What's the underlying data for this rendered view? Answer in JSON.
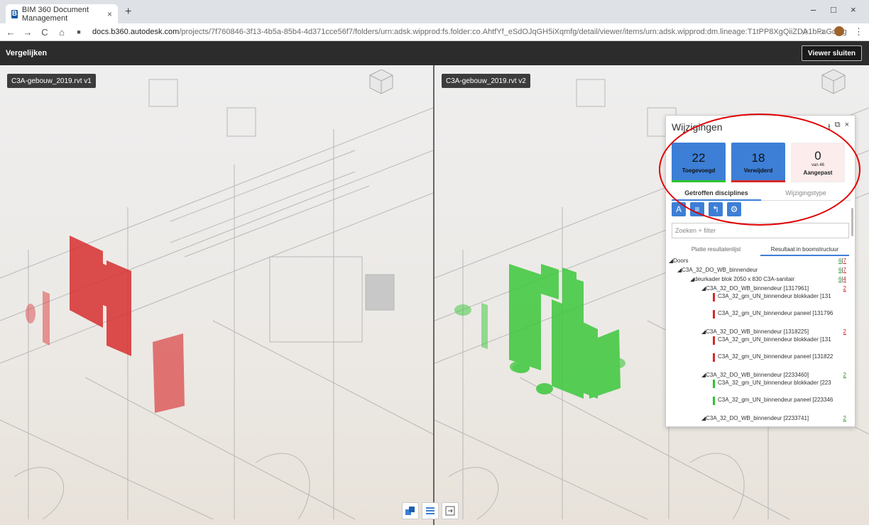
{
  "browser": {
    "tab_title": "BIM 360 Document Management",
    "tab_close": "×",
    "new_tab": "+",
    "url_host": "docs.b360.autodesk.com",
    "url_path": "/projects/7f760846-3f13-4b5a-85b4-4d371cce56f7/folders/urn:adsk.wipprod:fs.folder:co.AhtfYf_eSdOJqGH5iXqmfg/detail/viewer/items/urn:adsk.wipprod:dm.lineage:T1tPP8XgQiiZDA1bFaGcMg",
    "win_min": "–",
    "win_max": "□",
    "win_close": "×"
  },
  "app": {
    "title": "Vergelijken",
    "close_viewer": "Viewer sluiten"
  },
  "viewer": {
    "left_label": "C3A-gebouw_2019.rvt v1",
    "right_label": "C3A-gebouw_2019.rvt v2"
  },
  "changes_panel": {
    "title": "Wijzigingen",
    "added": {
      "count": "22",
      "label": "Toegevoegd"
    },
    "removed": {
      "count": "18",
      "label": "Verwijderd"
    },
    "modified": {
      "count": "0",
      "sub": "van 46",
      "label": "Aangepast"
    },
    "tab_disciplines": "Getroffen disciplines",
    "tab_change_type": "Wijzigingstype",
    "search_placeholder": "Zoeken + filter",
    "list_flat": "Platte resultatenlijst",
    "list_tree": "Resultaat in boomstructuur",
    "tree": [
      {
        "label": "◢Doors",
        "indent": 0,
        "added": "6",
        "removed": "7"
      },
      {
        "label": "◢C3A_32_DO_WB_binnendeur",
        "indent": 12,
        "added": "6",
        "removed": "7"
      },
      {
        "label": "◢deurkader blok 2050 x 830 C3A-sanitair",
        "indent": 30,
        "added": "6",
        "removed": "4"
      },
      {
        "label": "◢C3A_32_DO_WB_binnendeur [1317961]",
        "indent": 46,
        "removed": "2"
      },
      {
        "leaf": "C3A_32_gm_UN_binnendeur blokkader [131",
        "indent": 62,
        "status": "removed"
      },
      {
        "leaf": "C3A_32_gm_UN_binnendeur paneel [131796",
        "indent": 62,
        "status": "removed"
      },
      {
        "label": "◢C3A_32_DO_WB_binnendeur [1318225]",
        "indent": 46,
        "removed": "2"
      },
      {
        "leaf": "C3A_32_gm_UN_binnendeur blokkader [131",
        "indent": 62,
        "status": "removed"
      },
      {
        "leaf": "C3A_32_gm_UN_binnendeur paneel [131822",
        "indent": 62,
        "status": "removed"
      },
      {
        "label": "◢C3A_32_DO_WB_binnendeur [2233460]",
        "indent": 46,
        "added": "2"
      },
      {
        "leaf": "C3A_32_gm_UN_binnendeur blokkader [223",
        "indent": 62,
        "status": "added"
      },
      {
        "leaf": "C3A_32_gm_UN_binnendeur paneel [223346",
        "indent": 62,
        "status": "added"
      },
      {
        "label": "◢C3A_32_DO_WB_binnendeur [2233741]",
        "indent": 46,
        "added": "2"
      }
    ]
  },
  "colors": {
    "added": "#2fc42f",
    "removed": "#d42a2a",
    "accent": "#3d7fd6"
  }
}
